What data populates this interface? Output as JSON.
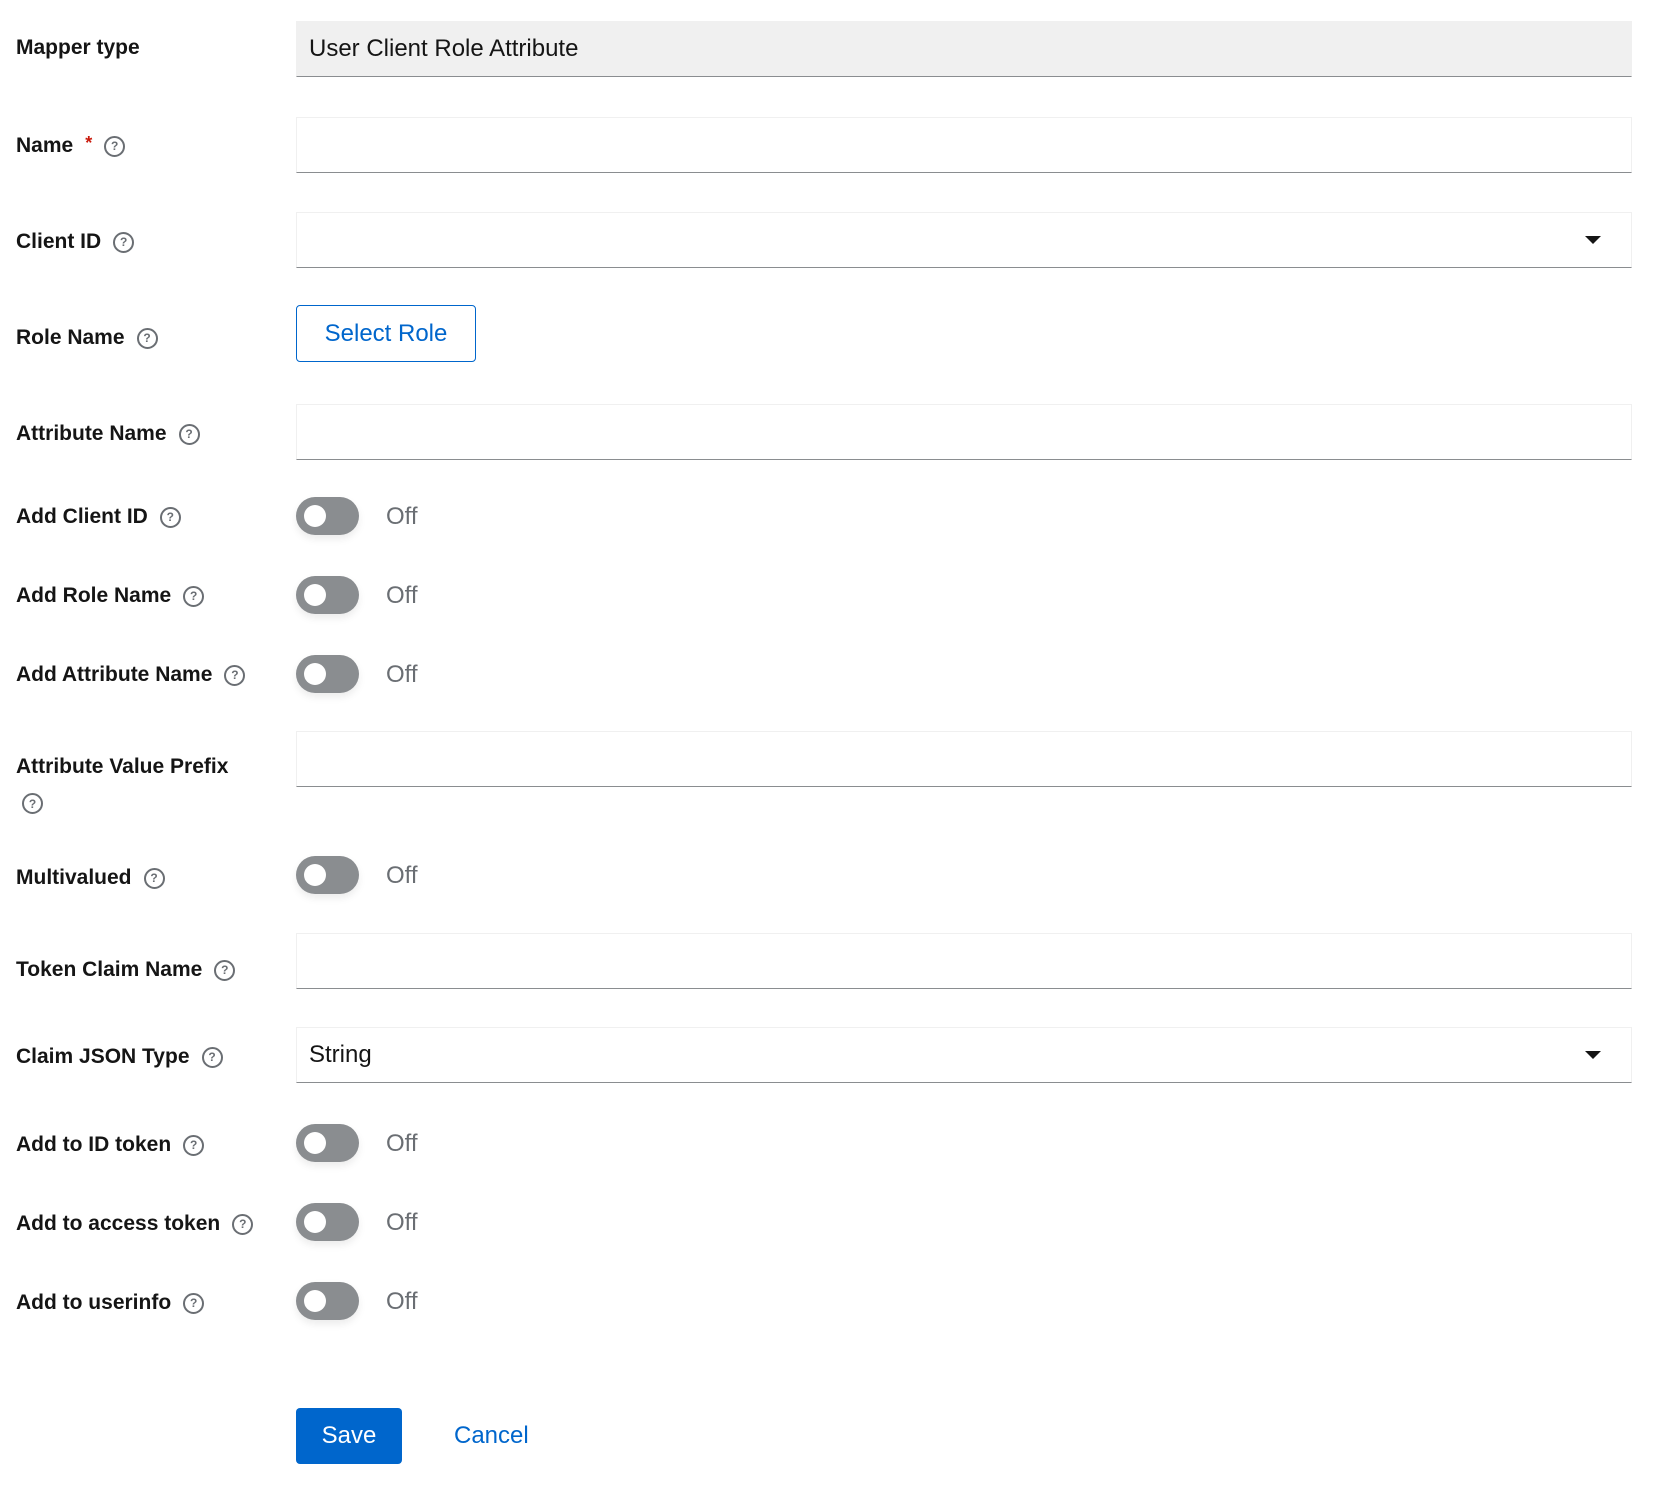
{
  "form": {
    "mapper_type": {
      "label": "Mapper type",
      "value": "User Client Role Attribute"
    },
    "name": {
      "label": "Name",
      "required_mark": "*",
      "value": "",
      "placeholder": ""
    },
    "client_id": {
      "label": "Client ID",
      "selected": ""
    },
    "role_name": {
      "label": "Role Name",
      "button_label": "Select Role"
    },
    "attribute_name": {
      "label": "Attribute Name",
      "value": ""
    },
    "add_client_id": {
      "label": "Add Client ID",
      "state": "Off",
      "checked": false
    },
    "add_role_name": {
      "label": "Add Role Name",
      "state": "Off",
      "checked": false
    },
    "add_attribute_name": {
      "label": "Add Attribute Name",
      "state": "Off",
      "checked": false
    },
    "attribute_value_prefix": {
      "label": "Attribute Value Prefix",
      "value": ""
    },
    "multivalued": {
      "label": "Multivalued",
      "state": "Off",
      "checked": false
    },
    "token_claim_name": {
      "label": "Token Claim Name",
      "value": ""
    },
    "claim_json_type": {
      "label": "Claim JSON Type",
      "selected": "String"
    },
    "add_to_id_token": {
      "label": "Add to ID token",
      "state": "Off",
      "checked": false
    },
    "add_to_access_token": {
      "label": "Add to access token",
      "state": "Off",
      "checked": false
    },
    "add_to_userinfo": {
      "label": "Add to userinfo",
      "state": "Off",
      "checked": false
    }
  },
  "help_icon_glyph": "?",
  "actions": {
    "save_label": "Save",
    "cancel_label": "Cancel"
  },
  "colors": {
    "primary": "#0066cc",
    "required": "#c9190b",
    "toggle_off": "#8a8d90",
    "muted_text": "#6a6e73",
    "readonly_bg": "#f0f0f0"
  }
}
